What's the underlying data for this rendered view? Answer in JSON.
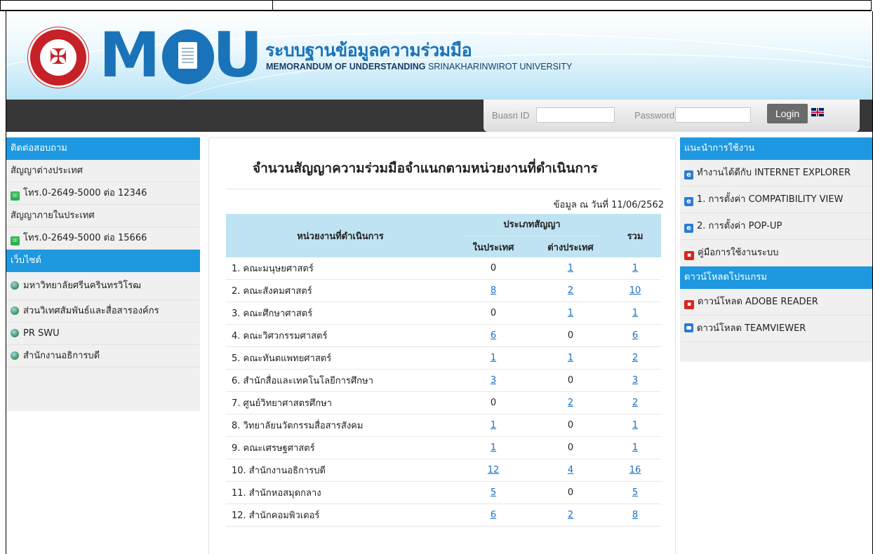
{
  "header": {
    "logo_left": "M",
    "logo_right": "U",
    "title_th": "ระบบฐานข้อมูลความร่วมมือ",
    "subtitle_bold": "MEMORANDUM OF UNDERSTANDING",
    "subtitle_rest": " SRINAKHARINWIROT UNIVERSITY"
  },
  "login": {
    "buasri_label": "Buasri ID",
    "password_label": "Password",
    "buasri_value": "",
    "password_value": "",
    "login_button": "Login"
  },
  "left_sidebar": {
    "contact_header": "ติดต่อสอบถาม",
    "contact_items": [
      {
        "label": "สัญญาต่างประเทศ",
        "icon": "none"
      },
      {
        "label": "โทร.0-2649-5000 ต่อ 12346",
        "icon": "phone-icon"
      },
      {
        "label": "สัญญาภายในประเทศ",
        "icon": "none"
      },
      {
        "label": "โทร.0-2649-5000 ต่อ 15666",
        "icon": "phone-icon"
      }
    ],
    "website_header": "เว็บไซต์",
    "website_items": [
      {
        "label": "มหาวิทยาลัยศรีนครินทรวิโรฒ",
        "icon": "globe-icon"
      },
      {
        "label": "ส่วนวิเทศสัมพันธ์และสื่อสารองค์กร",
        "icon": "globe-icon"
      },
      {
        "label": "PR SWU",
        "icon": "globe-icon"
      },
      {
        "label": "สำนักงานอธิการบดี",
        "icon": "globe-icon"
      }
    ]
  },
  "main": {
    "title": "จำนวนสัญญาความร่วมมือจำแนกตามหน่วยงานที่ดำเนินการ",
    "as_of": "ข้อมูล ณ วันที่ 11/06/2562",
    "table": {
      "col_unit": "หน่วยงานที่ดำเนินการ",
      "col_type": "ประเภทสัญญา",
      "col_total": "รวม",
      "col_domestic": "ในประเทศ",
      "col_foreign": "ต่างประเทศ",
      "rows": [
        {
          "unit": "1. คณะมนุษยศาสตร์",
          "domestic": "0",
          "foreign": "1",
          "total": "1"
        },
        {
          "unit": "2. คณะสังคมศาสตร์",
          "domestic": "8",
          "foreign": "2",
          "total": "10"
        },
        {
          "unit": "3. คณะศึกษาศาสตร์",
          "domestic": "0",
          "foreign": "1",
          "total": "1"
        },
        {
          "unit": "4. คณะวิศวกรรมศาสตร์",
          "domestic": "6",
          "foreign": "0",
          "total": "6"
        },
        {
          "unit": "5. คณะทันตแพทยศาสตร์",
          "domestic": "1",
          "foreign": "1",
          "total": "2"
        },
        {
          "unit": "6. สำนักสื่อและเทคโนโลยีการศึกษา",
          "domestic": "3",
          "foreign": "0",
          "total": "3"
        },
        {
          "unit": "7. ศูนย์วิทยาศาสตรศึกษา",
          "domestic": "0",
          "foreign": "2",
          "total": "2"
        },
        {
          "unit": "8. วิทยาลัยนวัตกรรมสื่อสารสังคม",
          "domestic": "1",
          "foreign": "0",
          "total": "1"
        },
        {
          "unit": "9. คณะเศรษฐศาสตร์",
          "domestic": "1",
          "foreign": "0",
          "total": "1"
        },
        {
          "unit": "10. สำนักงานอธิการบดี",
          "domestic": "12",
          "foreign": "4",
          "total": "16"
        },
        {
          "unit": "11. สำนักหอสมุดกลาง",
          "domestic": "5",
          "foreign": "0",
          "total": "5"
        },
        {
          "unit": "12. สำนักคอมพิวเตอร์",
          "domestic": "6",
          "foreign": "2",
          "total": "8"
        }
      ]
    }
  },
  "right_sidebar": {
    "guide_header": "แนะนำการใช้งาน",
    "guide_items": [
      {
        "label": "ทำงานได้ดีกับ INTERNET EXPLORER",
        "icon": "ie-icon"
      },
      {
        "label": "1. การตั้งค่า COMPATIBILITY VIEW",
        "icon": "ie-icon"
      },
      {
        "label": "2. การตั้งค่า POP-UP",
        "icon": "ie-icon"
      },
      {
        "label": "คู่มือการใช้งานระบบ",
        "icon": "pdf-icon"
      }
    ],
    "download_header": "ดาวน์โหลดโปรแกรม",
    "download_items": [
      {
        "label": "ดาวน์โหลด ADOBE READER",
        "icon": "pdf-icon"
      },
      {
        "label": "ดาวน์โหลด TEAMVIEWER",
        "icon": "teamviewer-icon"
      }
    ]
  },
  "colors": {
    "brand_blue": "#1a73b8",
    "sidebar_header": "#1e98e0",
    "table_header": "#bfe3f2",
    "link": "#1a6fc4",
    "login_bar": "#373737"
  }
}
